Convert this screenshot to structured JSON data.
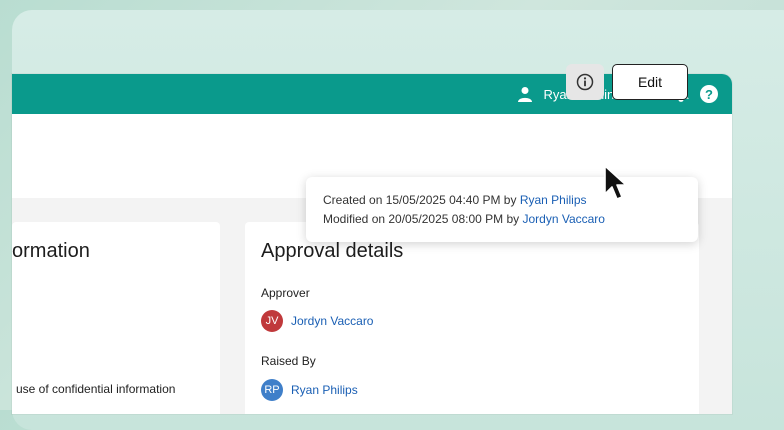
{
  "topbar": {
    "user_label": "Ryan/Administrator",
    "user_icon": "user-icon",
    "bell_icon": "bell-icon",
    "help_label": "?",
    "accent_color": "#0a9a8c"
  },
  "toolbar": {
    "info_icon": "info-icon",
    "edit_label": "Edit"
  },
  "tooltip": {
    "created_prefix": "Created on 15/05/2025  04:40 PM by ",
    "created_by": "Ryan Philips",
    "modified_prefix": "Modified on 20/05/2025  08:00 PM by ",
    "modified_by": "Jordyn Vaccaro"
  },
  "left_card": {
    "title": "ormation",
    "text": "use of confidential information"
  },
  "approval": {
    "title": "Approval details",
    "approver_label": "Approver",
    "approver_initials": "JV",
    "approver_name": "Jordyn Vaccaro",
    "approver_color": "#c0393b",
    "raised_label": "Raised By",
    "raised_initials": "RP",
    "raised_name": "Ryan Philips",
    "raised_color": "#3f7fc9"
  }
}
